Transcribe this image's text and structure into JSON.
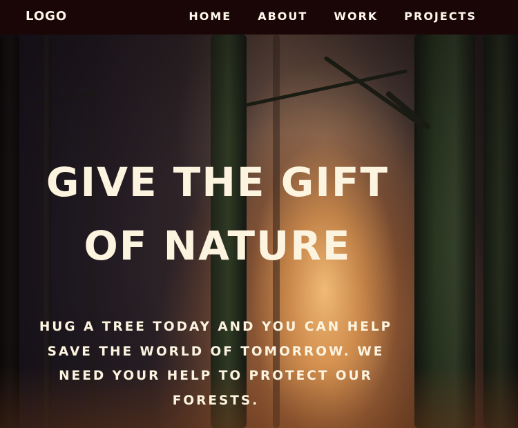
{
  "nav": {
    "logo": "LOGO",
    "links": [
      "HOME",
      "ABOUT",
      "WORK",
      "PROJECTS"
    ]
  },
  "hero": {
    "title": "GIVE THE GIFT OF NATURE",
    "subtitle": "HUG A TREE TODAY AND YOU CAN HELP SAVE THE WORLD OF TOMORROW. WE NEED YOUR HELP TO PROTECT OUR FORESTS."
  },
  "colors": {
    "nav_background": "#1a0606",
    "text": "#fdf4e0"
  }
}
